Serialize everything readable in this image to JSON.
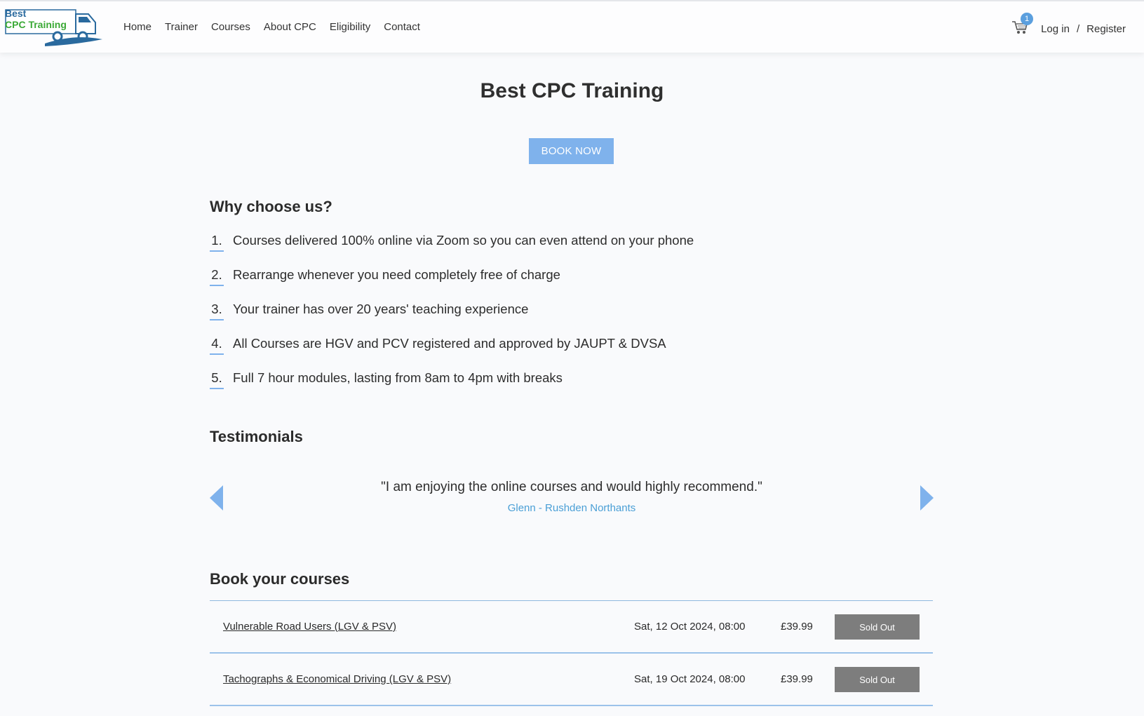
{
  "header": {
    "logo": {
      "line1": "Best",
      "line2": "CPC Training"
    },
    "nav": [
      "Home",
      "Trainer",
      "Courses",
      "About CPC",
      "Eligibility",
      "Contact"
    ],
    "cart_count": "1",
    "login": "Log in",
    "separator": "/",
    "register": "Register"
  },
  "hero": {
    "title": "Best CPC Training",
    "book_button": "BOOK NOW"
  },
  "why": {
    "title": "Why choose us?",
    "items": [
      {
        "num": "1.",
        "text": "Courses delivered 100% online via Zoom so you can even attend on your phone"
      },
      {
        "num": "2.",
        "text": "Rearrange whenever you need completely free of charge"
      },
      {
        "num": "3.",
        "text": "Your trainer has over 20 years' teaching experience"
      },
      {
        "num": "4.",
        "text": "All Courses are HGV and PCV registered and approved by JAUPT & DVSA"
      },
      {
        "num": "5.",
        "text": "Full 7 hour modules, lasting from 8am to 4pm with breaks"
      }
    ]
  },
  "testimonials": {
    "title": "Testimonials",
    "quote": "\"I am enjoying the online courses and would highly recommend.\"",
    "author": "Glenn - Rushden Northants"
  },
  "courses": {
    "title": "Book your courses",
    "rows": [
      {
        "name": "Vulnerable Road Users (LGV & PSV)",
        "date": "Sat, 12 Oct 2024, 08:00",
        "price": "£39.99",
        "status": "Sold Out"
      },
      {
        "name": "Tachographs & Economical Driving (LGV & PSV)",
        "date": "Sat, 19 Oct 2024, 08:00",
        "price": "£39.99",
        "status": "Sold Out"
      }
    ]
  },
  "colors": {
    "accent": "#7fb2ec",
    "badge": "#5b9fde",
    "author": "#4a9fd6",
    "sold_out": "#7d7d7d",
    "logo_blue": "#2a6a9e",
    "logo_green": "#3aa935"
  }
}
